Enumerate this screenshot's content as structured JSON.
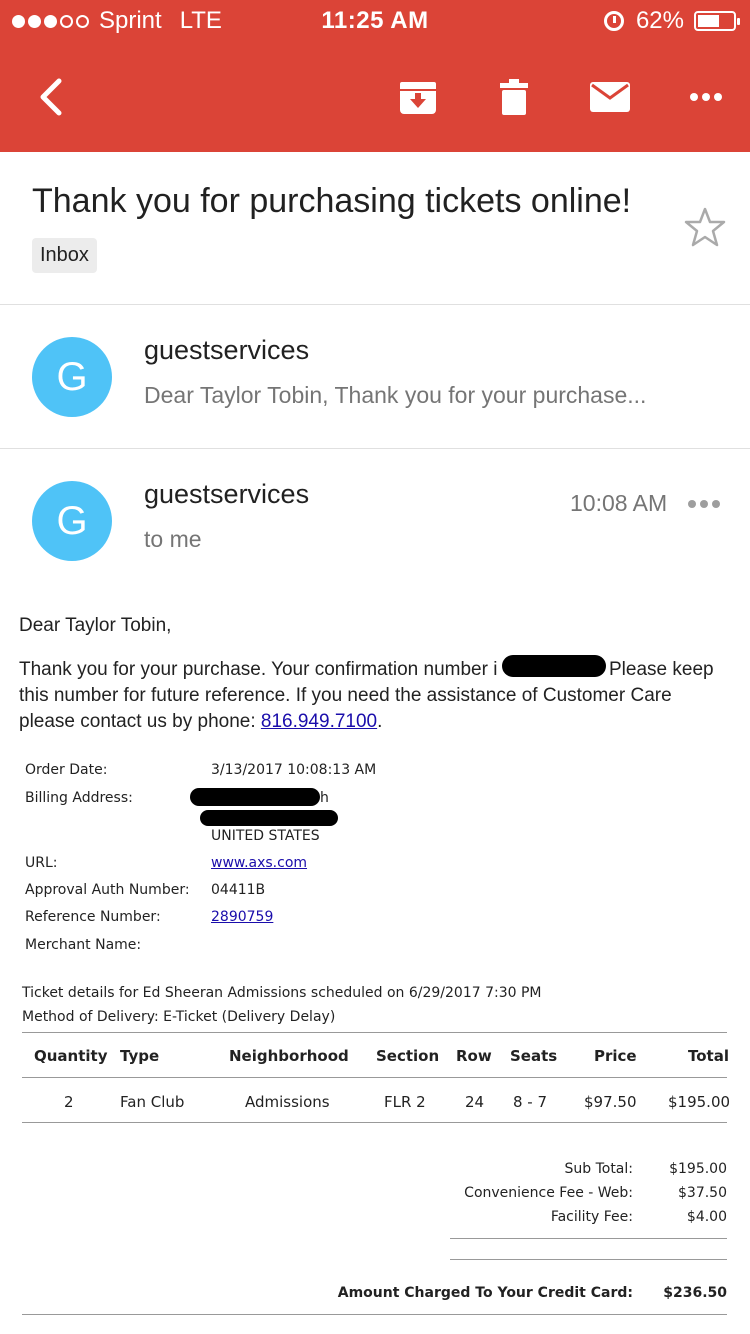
{
  "status_bar": {
    "carrier": "Sprint",
    "network": "LTE",
    "time": "11:25 AM",
    "battery": "62%",
    "battery_level": 0.62,
    "signal_bars": 3
  },
  "toolbar": {
    "icons": [
      "back-arrow",
      "archive",
      "trash",
      "mail",
      "more"
    ]
  },
  "email": {
    "subject": "Thank you for purchasing tickets online!",
    "label": "Inbox",
    "collapsed": {
      "avatar_letter": "G",
      "sender": "guestservices",
      "snippet": "Dear Taylor Tobin, Thank you for your purchase..."
    },
    "expanded": {
      "avatar_letter": "G",
      "sender": "guestservices",
      "recipient": "to me",
      "time": "10:08 AM"
    }
  },
  "body": {
    "greeting": "Dear Taylor Tobin,",
    "para_line1": "Thank you for your purchase. Your confirmation number i",
    "para_line1_end": "Please keep",
    "para_line2": "this number for future reference. If you need the assistance of Customer Care",
    "para_line3": "please contact us by phone:",
    "phone": "816.949.7100",
    "period": "."
  },
  "order_info": {
    "labels": [
      "Order Date:",
      "Billing Address:",
      "URL:",
      "Approval Auth Number:",
      "Reference Number:",
      "Merchant Name:"
    ],
    "order_date": "3/13/2017 10:08:13 AM",
    "billing_partial": "h",
    "billing_country": "UNITED STATES",
    "url": "www.axs.com",
    "approval": "04411B",
    "reference": "2890759",
    "merchant": ""
  },
  "ticket": {
    "line1": "Ticket details for Ed Sheeran Admissions scheduled on 6/29/2017 7:30 PM",
    "line2": "Method of Delivery: E-Ticket (Delivery Delay)"
  },
  "table": {
    "headers": [
      "Quantity",
      "Type",
      "Neighborhood",
      "Section",
      "Row",
      "Seats",
      "Price",
      "Total"
    ],
    "row": [
      "2",
      "Fan Club",
      "Admissions",
      "FLR 2",
      "24",
      "8 - 7",
      "$97.50",
      "$195.00"
    ]
  },
  "summary": {
    "sub_total_label": "Sub Total:",
    "sub_total": "$195.00",
    "conv_label": "Convenience Fee - Web:",
    "conv": "$37.50",
    "facility_label": "Facility Fee:",
    "facility": "$4.00",
    "charged_label": "Amount Charged To Your Credit Card:",
    "charged": "$236.50"
  },
  "colors": {
    "header": "#db4437",
    "avatar": "#4fc3f7",
    "link": "#1a0dab"
  }
}
